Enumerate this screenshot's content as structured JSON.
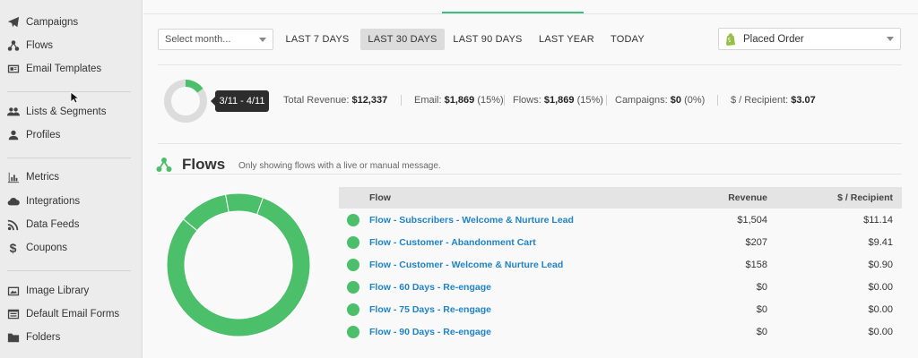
{
  "sidebar": {
    "items": [
      {
        "label": "Campaigns",
        "icon": "paper-plane-icon"
      },
      {
        "label": "Flows",
        "icon": "flows-icon"
      },
      {
        "label": "Email Templates",
        "icon": "email-template-icon"
      },
      {
        "label": "Lists & Segments",
        "icon": "users-icon"
      },
      {
        "label": "Profiles",
        "icon": "user-icon"
      },
      {
        "label": "Metrics",
        "icon": "bar-chart-icon"
      },
      {
        "label": "Integrations",
        "icon": "cloud-icon"
      },
      {
        "label": "Data Feeds",
        "icon": "rss-icon"
      },
      {
        "label": "Coupons",
        "icon": "dollar-icon"
      },
      {
        "label": "Image Library",
        "icon": "image-icon"
      },
      {
        "label": "Default Email Forms",
        "icon": "form-icon"
      },
      {
        "label": "Folders",
        "icon": "folder-icon"
      }
    ]
  },
  "filters": {
    "month_select": "Select month...",
    "ranges": [
      "LAST 7 DAYS",
      "LAST 30 DAYS",
      "LAST 90 DAYS",
      "LAST YEAR",
      "TODAY"
    ],
    "active_range": "LAST 30 DAYS",
    "metric_select": "Placed Order"
  },
  "summary": {
    "tooltip": "3/11 - 4/11",
    "total_revenue_label": "Total Revenue:",
    "total_revenue": "$12,337",
    "email_label": "Email:",
    "email_value": "$1,869",
    "email_pct": "(15%)",
    "flows_label": "Flows:",
    "flows_value": "$1,869",
    "flows_pct": "(15%)",
    "campaigns_label": "Campaigns:",
    "campaigns_value": "$0",
    "campaigns_pct": "(0%)",
    "per_recipient_label": "$ / Recipient:",
    "per_recipient_value": "$3.07"
  },
  "flows_section": {
    "title": "Flows",
    "subtitle": "Only showing flows with a live or manual message.",
    "columns": {
      "flow": "Flow",
      "revenue": "Revenue",
      "per_recipient": "$ / Recipient"
    },
    "rows": [
      {
        "name": "Flow - Subscribers - Welcome & Nurture Lead",
        "revenue": "$1,504",
        "per_recipient": "$11.14"
      },
      {
        "name": "Flow - Customer - Abandonment Cart",
        "revenue": "$207",
        "per_recipient": "$9.41"
      },
      {
        "name": "Flow - Customer - Welcome & Nurture Lead",
        "revenue": "$158",
        "per_recipient": "$0.90"
      },
      {
        "name": "Flow - 60 Days - Re-engage",
        "revenue": "$0",
        "per_recipient": "$0.00"
      },
      {
        "name": "Flow - 75 Days - Re-engage",
        "revenue": "$0",
        "per_recipient": "$0.00"
      },
      {
        "name": "Flow - 90 Days - Re-engage",
        "revenue": "$0",
        "per_recipient": "$0.00"
      }
    ]
  },
  "colors": {
    "accent_green": "#4cbf6b",
    "link_blue": "#1f83c8",
    "donut_gray": "#dcdcdc"
  },
  "summary_share_fraction": 0.15
}
